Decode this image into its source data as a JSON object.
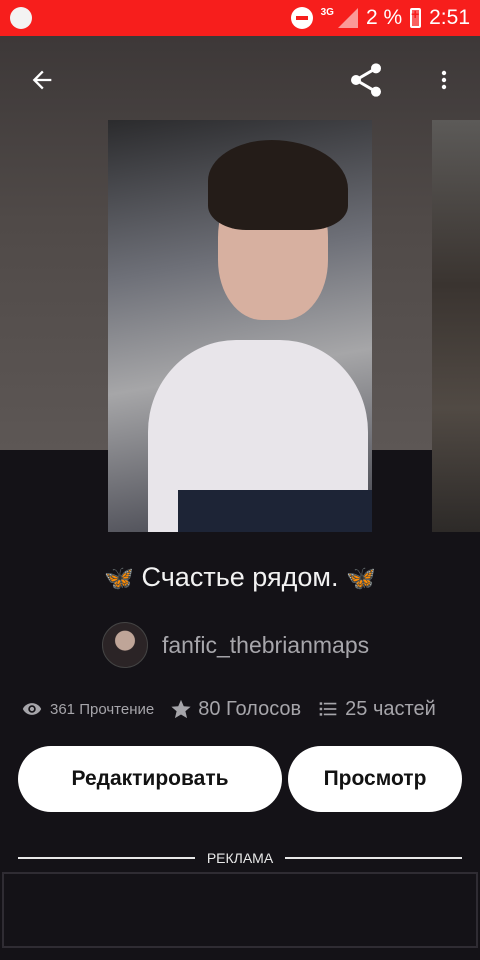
{
  "status_bar": {
    "network": "3G",
    "battery": "2 %",
    "time": "2:51"
  },
  "story": {
    "title": "Счастье рядом.",
    "title_emoji_left": "🦋",
    "title_emoji_right": "🦋",
    "author": "fanfic_thebrianmaps",
    "reads": "361 Прочтение",
    "votes": "80 Голосов",
    "parts": "25 частей"
  },
  "actions": {
    "edit_label": "Редактировать",
    "view_label": "Просмотр"
  },
  "ad": {
    "label": "РЕКЛАМА"
  },
  "icons": {
    "back": "back-arrow-icon",
    "share": "share-icon",
    "more": "more-vert-icon",
    "eye": "eye-icon",
    "star": "star-icon",
    "list": "list-icon"
  },
  "colors": {
    "status_bar": "#f71e1c",
    "background": "#141217",
    "accent_butterfly": "#f19320",
    "button": "#ffffff"
  }
}
